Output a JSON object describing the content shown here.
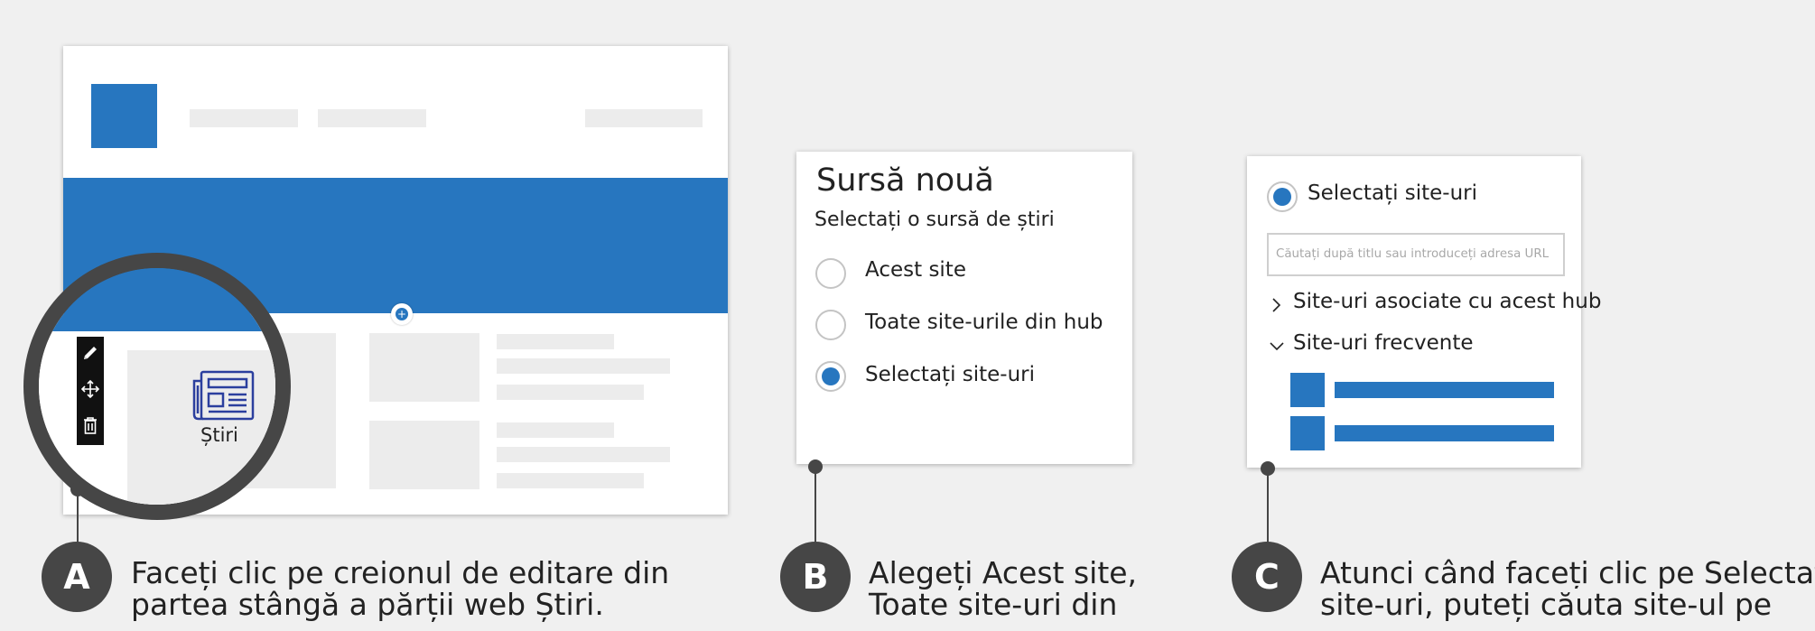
{
  "panel_b": {
    "title": "Sursă nouă",
    "subtitle": "Selectați o sursă de știri",
    "options": [
      {
        "label": "Acest site",
        "selected": false
      },
      {
        "label": "Toate site-urile din hub",
        "selected": false
      },
      {
        "label": "Selectați site-uri",
        "selected": true
      }
    ]
  },
  "panel_a": {
    "news_label": "Știri",
    "toolbar_icons": [
      "pencil-icon",
      "move-icon",
      "trash-icon"
    ]
  },
  "panel_c": {
    "selected_option": "Selectați site-uri",
    "search_placeholder": "Căutați după titlu sau introduceți adresa URL",
    "associated_label": "Site-uri asociate cu acest hub",
    "frequent_label": "Site-uri frecvente"
  },
  "steps": {
    "a": {
      "letter": "A",
      "line1": "Faceți clic pe creionul de editare din",
      "line2": "partea stângă a părții web Știri."
    },
    "b": {
      "letter": "B",
      "line1": "Alegeți Acest site,",
      "line2": "Toate site-uri din"
    },
    "c": {
      "letter": "C",
      "line1": "Atunci când faceți clic pe Selectați",
      "line2": "site-uri, puteți căuta site-ul pe"
    }
  },
  "colors": {
    "accent": "#2776bf",
    "dark": "#464646",
    "placeholder": "#ececec"
  }
}
